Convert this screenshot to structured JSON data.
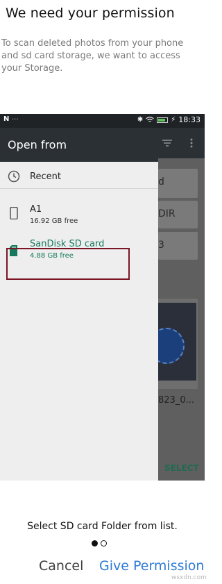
{
  "header": {
    "title": "We need your permission",
    "description": "To scan deleted photos from your phone and sd card storage, we want to access your Storage."
  },
  "status_bar": {
    "left_icon": "N",
    "dots": "...",
    "time": "18:33",
    "icons": [
      "bluetooth-icon",
      "wifi-icon",
      "battery-icon",
      "charging-bolt-icon"
    ]
  },
  "drawer": {
    "title": "Open from",
    "items": [
      {
        "label": "Recent",
        "icon": "clock-icon"
      },
      {
        "label": "A1",
        "sub": "16.92 GB free",
        "icon": "phone-icon"
      },
      {
        "label": "SanDisk SD card",
        "sub": "4.88 GB free",
        "icon": "sd-card-icon"
      }
    ]
  },
  "background_app": {
    "card1": "d",
    "card2": "DIR",
    "card3": "3",
    "thumb_label": "823_0...",
    "select_label": "SELECT"
  },
  "footer": {
    "caption": "Select SD card Folder from list.",
    "page_indicator": {
      "current": 1,
      "total": 2
    },
    "cancel_label": "Cancel",
    "give_label": "Give Permission",
    "watermark": "wsxdn.com"
  },
  "colors": {
    "accent_blue": "#2e7bd3",
    "sd_green": "#16795d",
    "highlight_border": "#7b1526",
    "toolbar": "#2b3034"
  }
}
